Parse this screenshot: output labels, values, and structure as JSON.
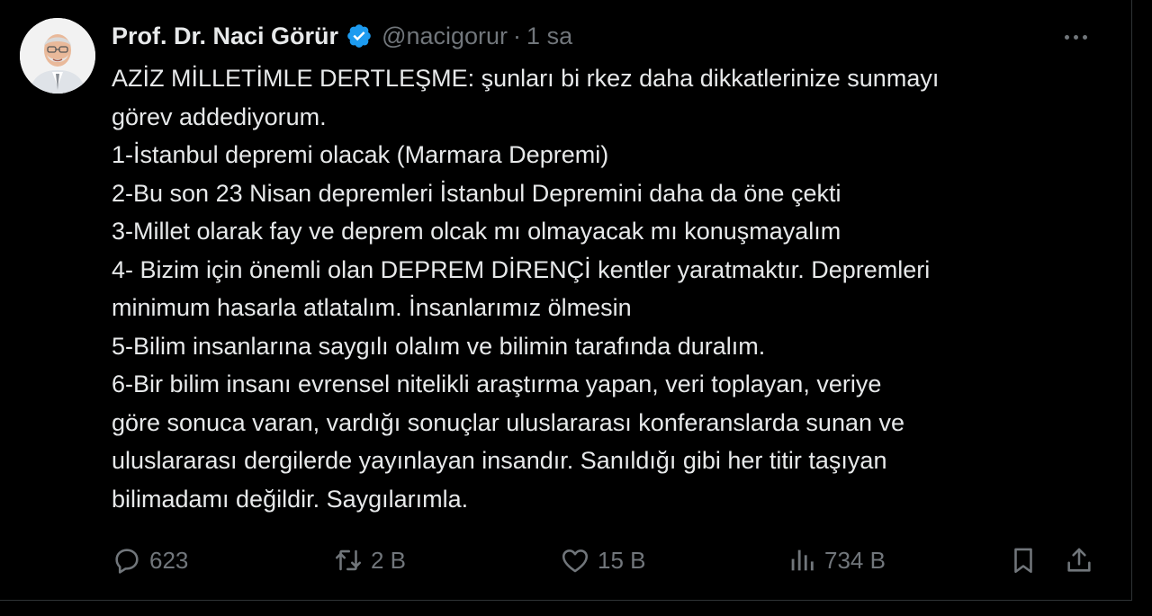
{
  "tweet": {
    "author": {
      "name": "Prof. Dr. Naci Görür",
      "handle": "@nacigorur",
      "separator": "·",
      "time": "1 sa",
      "verified": true
    },
    "lines": [
      "AZİZ MİLLETİMLE DERTLEŞME: şunları bi rkez daha dikkatlerinize sunmayı",
      "görev addediyorum.",
      "1-İstanbul depremi olacak (Marmara Depremi)",
      "2-Bu son 23 Nisan depremleri İstanbul Depremini daha da öne çekti",
      "3-Millet olarak fay ve deprem olcak mı olmayacak mı konuşmayalım",
      "4- Bizim için önemli olan DEPREM DİRENÇİ kentler yaratmaktır. Depremleri",
      "minimum hasarla atlatalım. İnsanlarımız ölmesin",
      "5-Bilim insanlarına saygılı olalım ve bilimin tarafında duralım.",
      "6-Bir bilim insanı evrensel nitelikli araştırma yapan, veri toplayan, veriye",
      "göre sonuca varan, vardığı sonuçlar uluslararası konferanslarda sunan ve",
      "uluslararası dergilerde yayınlayan insandır. Sanıldığı gibi her titir taşıyan",
      "bilimadamı değildir. Saygılarımla."
    ],
    "actions": {
      "replies": "623",
      "retweets": "2 B",
      "likes": "15 B",
      "views": "734 B"
    }
  },
  "icons": {
    "verified": "verified-badge-icon",
    "more": "more-options-icon",
    "reply": "reply-icon",
    "retweet": "retweet-icon",
    "like": "heart-icon",
    "views": "views-icon",
    "bookmark": "bookmark-icon",
    "share": "share-icon"
  },
  "colors": {
    "background": "#000000",
    "text": "#e7e9ea",
    "secondary": "#71767b",
    "verified": "#1d9bf0",
    "border": "#2f3336"
  }
}
